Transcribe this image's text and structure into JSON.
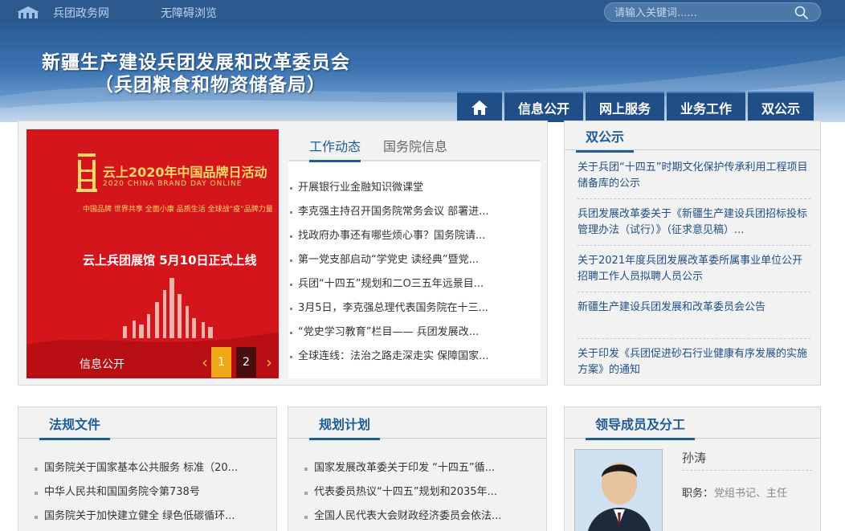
{
  "topbar": {
    "link1": "兵团政务网",
    "link2": "无障碍浏览",
    "search_placeholder": "请输入关键词......"
  },
  "banner": {
    "title_line1": "新疆生产建设兵团发展和改革委员会",
    "title_line2": "（兵团粮食和物资储备局）"
  },
  "nav": {
    "items": [
      "信息公开",
      "网上服务",
      "业务工作",
      "双公示"
    ]
  },
  "carousel": {
    "title": "云上2020年中国品牌日活动",
    "subtitle": "2020 CHINA BRAND DAY ONLINE",
    "slogans": "中国品牌 世界共享   全面小康 品质生活   全球战“疫”品牌力量",
    "headline": "云上兵团展馆  5月10日正式上线",
    "caption": "信息公开",
    "dots": [
      "1",
      "2"
    ]
  },
  "news": {
    "tabs": [
      "工作动态",
      "国务院信息"
    ],
    "items": [
      "开展银行业金融知识微课堂",
      "李克强主持召开国务院常务会议 部署进...",
      "找政府办事还有哪些烦心事？国务院请...",
      "第一党支部启动“学党史 读经典”暨党...",
      "兵团“十四五”规划和二O三五年远景目...",
      "3月5日，李克强总理代表国务院在十三...",
      "“党史学习教育”栏目—— 兵团发展改...",
      "全球连线：法治之路走深走实 保障国家..."
    ]
  },
  "dual": {
    "heading": "双公示",
    "items": [
      "关于兵团“十四五”时期文化保护传承利用工程项目储备库的公示",
      "兵团发展改革委关于《新疆生产建设兵团招标投标管理办法（试行）》（征求意见稿）...",
      "关于2021年度兵团发展改革委所属事业单位公开招聘工作人员拟聘人员公示",
      "新疆生产建设兵团发展和改革委员会公告",
      "关于印发《兵团促进砂石行业健康有序发展的实施方案》的通知"
    ]
  },
  "laws": {
    "heading": "法规文件",
    "items": [
      "国务院关于国家基本公共服务 标准（20...",
      "中华人民共和国国务院令第738号",
      "国务院关于加快建立健全 绿色低碳循环..."
    ]
  },
  "plans": {
    "heading": "规划计划",
    "items": [
      "国家发展改革委关于印发 “十四五”循...",
      "代表委员热议“十四五”规划和2035年...",
      "全国人民代表大会财政经济委员会依法..."
    ]
  },
  "leaders": {
    "heading": "领导成员及分工",
    "name": "孙涛",
    "role_label": "职务：",
    "role": "党组书记、主任"
  },
  "colors": {
    "topbar": "#2c5a8e",
    "nav": "#1f4f86",
    "accent": "#1d5c96",
    "carousel_red": "#d4161c"
  }
}
